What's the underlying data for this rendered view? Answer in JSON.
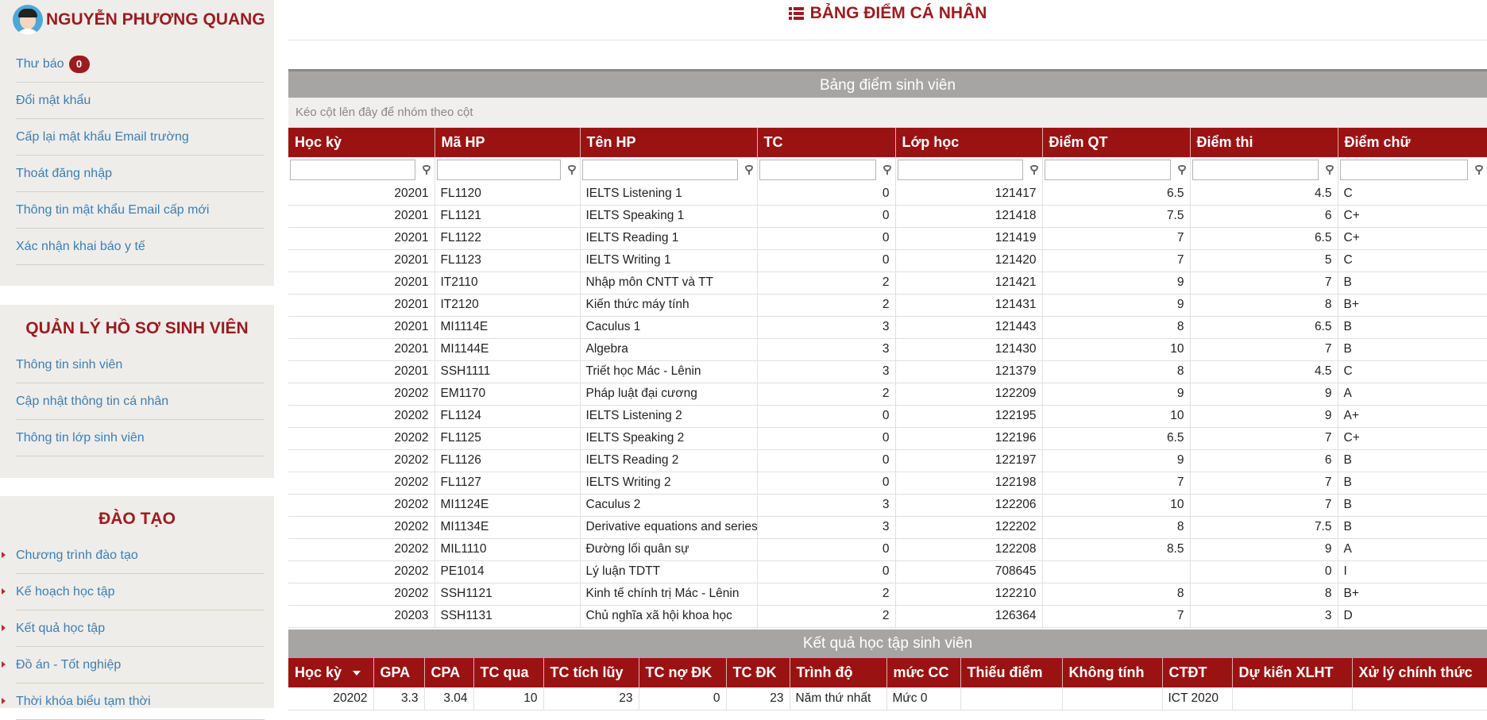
{
  "user": {
    "name": "NGUYỄN PHƯƠNG QUANG"
  },
  "menu1": [
    {
      "label": "Thư báo",
      "badge": "0"
    },
    {
      "label": "Đổi mật khẩu"
    },
    {
      "label": "Cấp lại mật khẩu Email trường"
    },
    {
      "label": "Thoát đăng nhập"
    },
    {
      "label": "Thông tin mật khẩu Email cấp mới"
    },
    {
      "label": "Xác nhận khai báo y tế"
    }
  ],
  "section2": {
    "title": "QUẢN LÝ HỒ SƠ SINH VIÊN",
    "items": [
      "Thông tin sinh viên",
      "Cập nhật thông tin cá nhân",
      "Thông tin lớp sinh viên"
    ]
  },
  "section3": {
    "title": "ĐÀO TẠO",
    "items": [
      "Chương trình đào tạo",
      "Kế hoạch học tập",
      "Kết quả học tập",
      "Đồ án - Tốt nghiệp",
      "Thời khóa biểu tạm thời"
    ]
  },
  "page": {
    "title": "BẢNG ĐIỂM CÁ NHÂN",
    "title_icon": "list-icon"
  },
  "grades": {
    "caption": "Bảng điểm sinh viên",
    "group_hint": "Kéo cột lên đây để nhóm theo cột",
    "columns": [
      "Học kỳ",
      "Mã HP",
      "Tên HP",
      "TC",
      "Lớp học",
      "Điểm QT",
      "Điểm thi",
      "Điểm chữ"
    ],
    "rows": [
      [
        "20201",
        "FL1120",
        "IELTS Listening 1",
        "0",
        "121417",
        "6.5",
        "4.5",
        "C"
      ],
      [
        "20201",
        "FL1121",
        "IELTS Speaking 1",
        "0",
        "121418",
        "7.5",
        "6",
        "C+"
      ],
      [
        "20201",
        "FL1122",
        "IELTS Reading 1",
        "0",
        "121419",
        "7",
        "6.5",
        "C+"
      ],
      [
        "20201",
        "FL1123",
        "IELTS Writing 1",
        "0",
        "121420",
        "7",
        "5",
        "C"
      ],
      [
        "20201",
        "IT2110",
        "Nhập môn CNTT và TT",
        "2",
        "121421",
        "9",
        "7",
        "B"
      ],
      [
        "20201",
        "IT2120",
        "Kiến thức máy tính",
        "2",
        "121431",
        "9",
        "8",
        "B+"
      ],
      [
        "20201",
        "MI1114E",
        "Caculus 1",
        "3",
        "121443",
        "8",
        "6.5",
        "B"
      ],
      [
        "20201",
        "MI1144E",
        "Algebra",
        "3",
        "121430",
        "10",
        "7",
        "B"
      ],
      [
        "20201",
        "SSH1111",
        "Triết học Mác - Lênin",
        "3",
        "121379",
        "8",
        "4.5",
        "C"
      ],
      [
        "20202",
        "EM1170",
        "Pháp luật đại cương",
        "2",
        "122209",
        "9",
        "9",
        "A"
      ],
      [
        "20202",
        "FL1124",
        "IELTS Listening 2",
        "0",
        "122195",
        "10",
        "9",
        "A+"
      ],
      [
        "20202",
        "FL1125",
        "IELTS Speaking 2",
        "0",
        "122196",
        "6.5",
        "7",
        "C+"
      ],
      [
        "20202",
        "FL1126",
        "IELTS Reading 2",
        "0",
        "122197",
        "9",
        "6",
        "B"
      ],
      [
        "20202",
        "FL1127",
        "IELTS Writing 2",
        "0",
        "122198",
        "7",
        "7",
        "B"
      ],
      [
        "20202",
        "MI1124E",
        "Caculus 2",
        "3",
        "122206",
        "10",
        "7",
        "B"
      ],
      [
        "20202",
        "MI1134E",
        "Derivative equations and series",
        "3",
        "122202",
        "8",
        "7.5",
        "B"
      ],
      [
        "20202",
        "MIL1110",
        "Đường lối quân sự",
        "0",
        "122208",
        "8.5",
        "9",
        "A"
      ],
      [
        "20202",
        "PE1014",
        "Lý luận TDTT",
        "0",
        "708645",
        "",
        "0",
        "I"
      ],
      [
        "20202",
        "SSH1121",
        "Kinh tế chính trị Mác - Lênin",
        "2",
        "122210",
        "8",
        "8",
        "B+"
      ],
      [
        "20203",
        "SSH1131",
        "Chủ nghĩa xã hội khoa học",
        "2",
        "126364",
        "7",
        "3",
        "D"
      ]
    ]
  },
  "results": {
    "caption": "Kết quả học tập sinh viên",
    "columns": [
      "Học kỳ",
      "GPA",
      "CPA",
      "TC qua",
      "TC tích lũy",
      "TC nợ ĐK",
      "TC ĐK",
      "Trình độ",
      "mức CC",
      "Thiếu điểm",
      "Không tính",
      "CTĐT",
      "Dự kiến XLHT",
      "Xử lý chính thức"
    ],
    "rows": [
      [
        "20202",
        "3.3",
        "3.04",
        "10",
        "23",
        "0",
        "23",
        "Năm thứ nhất",
        "Mức 0",
        "",
        "",
        "ICT 2020",
        "",
        ""
      ]
    ]
  },
  "colors": {
    "brand": "#9b1212",
    "link": "#3a7fb5"
  }
}
